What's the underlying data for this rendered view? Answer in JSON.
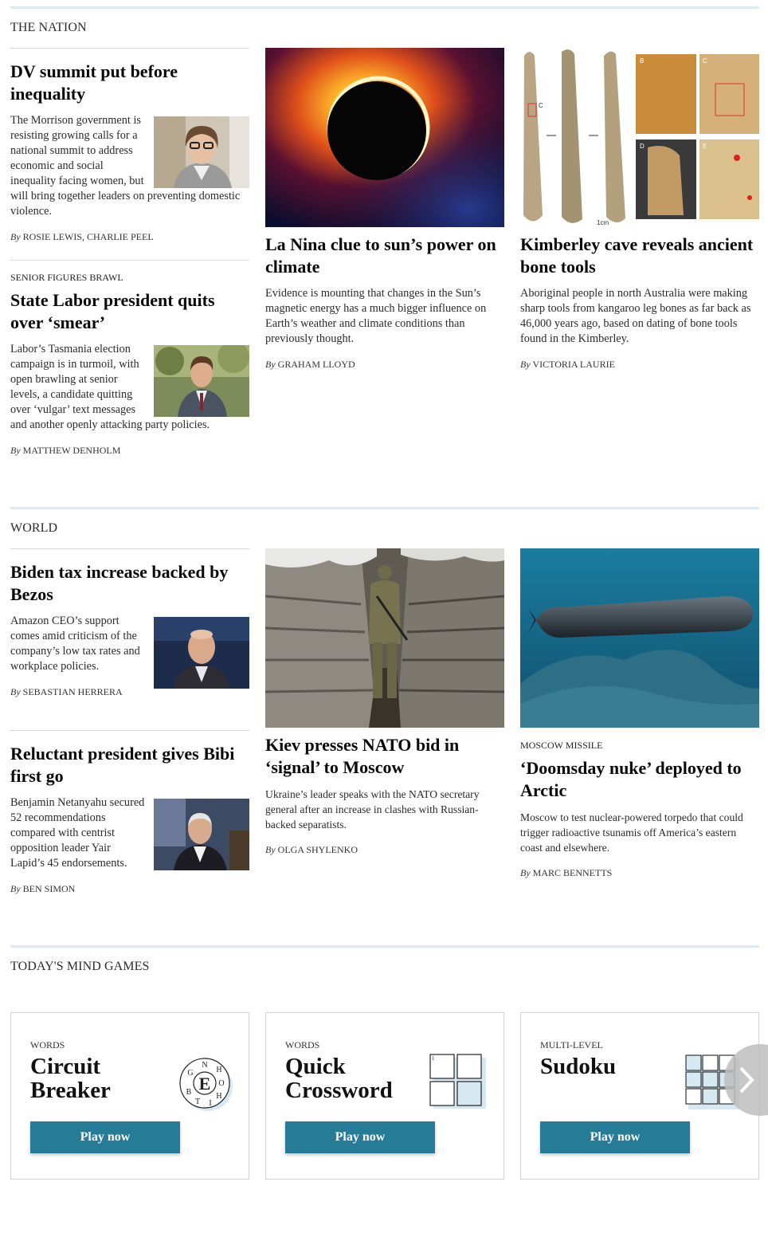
{
  "nation": {
    "title": "THE NATION",
    "lead": {
      "headline": "DV summit put before inequality",
      "body": "The Morrison government is resisting growing calls for a national summit to address economic and social inequality facing women, but will bring together leaders on preventing domestic violence.",
      "by": "By",
      "author": "ROSIE LEWIS, CHARLIE PEEL"
    },
    "second": {
      "kicker": "SENIOR FIGURES BRAWL",
      "headline": "State Labor president quits over ‘smear’",
      "body": "Labor’s Tasmania election campaign is in turmoil, with open brawling at senior levels, a candidate quitting over ‘vulgar’ text messages and another openly attacking party policies.",
      "by": "By",
      "author": "MATTHEW DENHOLM"
    },
    "col2": {
      "headline": "La Nina clue to sun’s power on climate",
      "body": "Evidence is mounting that changes in the Sun’s magnetic energy has a much bigger influence on Earth’s weather and climate conditions than previously thought.",
      "by": "By",
      "author": "GRAHAM LLOYD"
    },
    "col3": {
      "headline": "Kimberley cave reveals ancient bone tools",
      "body": "Aboriginal people in north Australia were making sharp tools from kangaroo leg bones as far back as 46,000 years ago, based on dating of bone tools found in the Kimberley.",
      "by": "By",
      "author": "VICTORIA LAURIE",
      "image_labels": {
        "b": "B",
        "c": "C",
        "d": "D",
        "e": "E",
        "c_marker": "C",
        "scale": "1cm"
      }
    }
  },
  "world": {
    "title": "WORLD",
    "lead": {
      "headline": "Biden tax increase backed by Bezos",
      "body": "Amazon CEO’s support comes amid criticism of the company’s low tax rates and workplace policies.",
      "by": "By",
      "author": "SEBASTIAN HERRERA"
    },
    "second": {
      "headline": "Reluctant president gives Bibi first go",
      "body": "Benjamin Netanyahu secured 52 recommendations compared with centrist opposition leader Yair Lapid’s 45 endorsements.",
      "by": "By",
      "author": "BEN SIMON"
    },
    "col2": {
      "headline": "Kiev presses NATO bid in ‘signal’ to Moscow",
      "body": "Ukraine’s leader speaks with the NATO secretary general after an increase in clashes with Russian-backed separatists.",
      "by": "By",
      "author": "OLGA SHYLENKO"
    },
    "col3": {
      "kicker": "MOSCOW MISSILE",
      "headline": "‘Doomsday nuke’ deployed to Arctic",
      "body": "Moscow to test nuclear-powered torpedo that could trigger radioactive tsunamis off America’s eastern coast and elsewhere.",
      "by": "By",
      "author": "MARC BENNETTS"
    }
  },
  "games": {
    "title": "TODAY'S MIND GAMES",
    "cards": [
      {
        "kicker": "WORDS",
        "title": "Circuit Breaker",
        "button": "Play now",
        "letters": {
          "center": "E",
          "ring": [
            "N",
            "H",
            "O",
            "H",
            "I",
            "T",
            "B",
            "G"
          ]
        }
      },
      {
        "kicker": "WORDS",
        "title": "Quick Crossword",
        "button": "Play now",
        "cell_number": "1"
      },
      {
        "kicker": "MULTI-LEVEL",
        "title": "Sudoku",
        "button": "Play now"
      }
    ]
  },
  "colors": {
    "rule": "#dce9ef",
    "button": "#267b97"
  }
}
